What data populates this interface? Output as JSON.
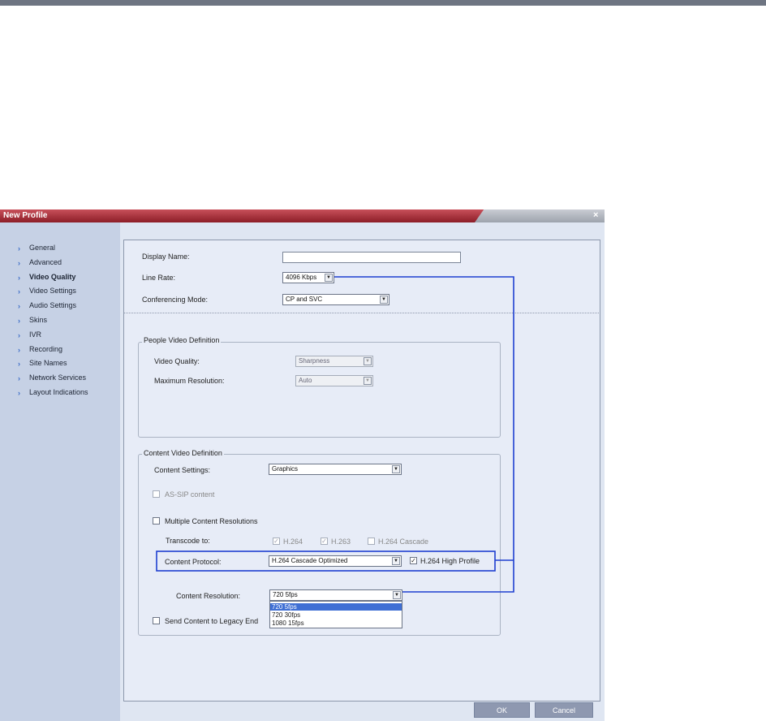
{
  "window": {
    "title": "New Profile",
    "close_glyph": "×"
  },
  "sidebar": {
    "items": [
      {
        "label": "General"
      },
      {
        "label": "Advanced"
      },
      {
        "label": "Video Quality"
      },
      {
        "label": "Video Settings"
      },
      {
        "label": "Audio Settings"
      },
      {
        "label": "Skins"
      },
      {
        "label": "IVR"
      },
      {
        "label": "Recording"
      },
      {
        "label": "Site Names"
      },
      {
        "label": "Network Services"
      },
      {
        "label": "Layout Indications"
      }
    ],
    "active_item": "Video Quality",
    "chevron_glyph": "›"
  },
  "form": {
    "display_name": {
      "label": "Display Name:",
      "value": ""
    },
    "line_rate": {
      "label": "Line Rate:",
      "value": "4096 Kbps"
    },
    "conferencing_mode": {
      "label": "Conferencing Mode:",
      "value": "CP and SVC"
    }
  },
  "people_video": {
    "legend": "People Video Definition",
    "video_quality": {
      "label": "Video Quality:",
      "value": "Sharpness"
    },
    "max_resolution": {
      "label": "Maximum Resolution:",
      "value": "Auto"
    }
  },
  "content_video": {
    "legend": "Content Video Definition",
    "content_settings": {
      "label": "Content Settings:",
      "value": "Graphics"
    },
    "as_sip_content": {
      "label": "AS-SIP content",
      "checked": false
    },
    "multiple_content_resolutions": {
      "label": "Multiple Content Resolutions",
      "checked": false
    },
    "transcode_to": {
      "label": "Transcode to:",
      "options": [
        {
          "label": "H.264",
          "checked": true
        },
        {
          "label": "H.263",
          "checked": true
        },
        {
          "label": "H.264 Cascade",
          "checked": false
        }
      ]
    },
    "content_protocol": {
      "label": "Content Protocol:",
      "value": "H.264 Cascade Optimized"
    },
    "h264_high_profile": {
      "label": "H.264 High Profile",
      "checked": true
    },
    "content_resolution": {
      "label": "Content Resolution:",
      "value": "720 5fps",
      "options": [
        "720 5fps",
        "720 30fps",
        "1080 15fps"
      ],
      "highlighted_option": "720 5fps"
    },
    "send_to_legacy": {
      "label": "Send Content to Legacy End",
      "checked": false
    }
  },
  "buttons": {
    "ok": "OK",
    "cancel": "Cancel"
  },
  "glyphs": {
    "check": "✓",
    "dropdown_arrow": "▼"
  },
  "colors": {
    "title_bar": "#a52a34",
    "callout": "#1f3fd0",
    "selection": "#3f6fd4",
    "sidebar": "#c6d1e5"
  }
}
